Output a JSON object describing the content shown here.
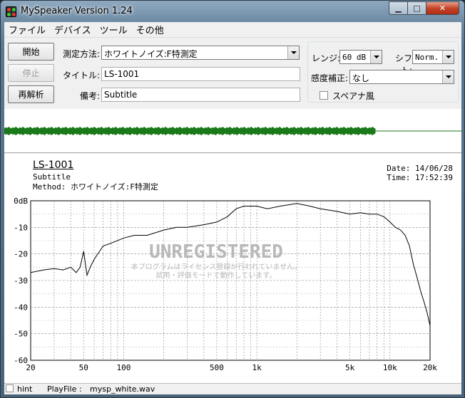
{
  "window": {
    "title": "MySpeaker Version 1.24"
  },
  "menu": [
    "ファイル",
    "デバイス",
    "ツール",
    "その他"
  ],
  "controls": {
    "start_label": "開始",
    "stop_label": "停止",
    "reanalyze_label": "再解析",
    "method_label": "測定方法:",
    "method_value": "ホワイトノイズ:F特測定",
    "title_label": "タイトル:",
    "title_value": "LS-1001",
    "note_label": "備考:",
    "note_value": "Subtitle",
    "range_label": "レンジ:",
    "range_value": "60 dB",
    "shift_label": "シフト:",
    "shift_value": "Norm.",
    "sens_label": "感度補正:",
    "sens_value": "なし",
    "spectrum_label": "スペアナ風"
  },
  "graph": {
    "title": "LS-1001",
    "subtitle": "Subtitle",
    "method": "Method:  ホワイトノイズ:F特測定",
    "date": "Date: 14/06/28",
    "time": "Time: 17:52:39",
    "watermark": "UNREGISTERED",
    "watermark_line1": "本プログラムはライセンス登録が行われていません。",
    "watermark_line2": "試用・評価モードで動作しています。"
  },
  "colors": {
    "curve": "#000000",
    "wave": "#1a7a1a",
    "grid": "#888888"
  },
  "chart_data": {
    "type": "line",
    "x_scale": "log",
    "xlim": [
      20,
      20000
    ],
    "ylim": [
      -60,
      0
    ],
    "x_ticks": [
      20,
      50,
      100,
      500,
      1000,
      5000,
      10000,
      20000
    ],
    "x_tick_labels": [
      "20",
      "50",
      "100",
      "500",
      "1k",
      "5k",
      "10k",
      "20k"
    ],
    "y_ticks": [
      0,
      -10,
      -20,
      -30,
      -40,
      -50,
      -60
    ],
    "y_tick_labels": [
      "0dB",
      "-10",
      "-20",
      "-30",
      "-40",
      "-50",
      "-60"
    ],
    "grid": true,
    "series": [
      {
        "x": [
          20,
          25,
          30,
          35,
          40,
          44,
          47,
          50,
          53,
          56,
          60,
          70,
          80,
          100,
          120,
          150,
          200,
          250,
          300,
          400,
          500,
          600,
          700,
          800,
          1000,
          1200,
          1500,
          2000,
          2500,
          3000,
          4000,
          5000,
          6000,
          7000,
          8000,
          9000,
          10000,
          11000,
          12000,
          13000,
          14000,
          15000,
          16000,
          17000,
          18000,
          19000,
          20000
        ],
        "y": [
          -27,
          -26,
          -25.5,
          -26,
          -25,
          -27,
          -25,
          -19,
          -28,
          -25,
          -22,
          -17,
          -16,
          -14,
          -13,
          -13,
          -11,
          -10,
          -10,
          -9,
          -8,
          -6,
          -3,
          -2,
          -2,
          -3,
          -2,
          -1,
          -2,
          -3,
          -4,
          -5,
          -4.5,
          -5,
          -5,
          -6,
          -8,
          -10,
          -11,
          -13,
          -17,
          -24,
          -29,
          -34,
          -38,
          -42,
          -47
        ]
      }
    ]
  },
  "status": {
    "hint_label": "hint",
    "playfile_label": "PlayFile :",
    "playfile_value": "mysp_white.wav"
  }
}
